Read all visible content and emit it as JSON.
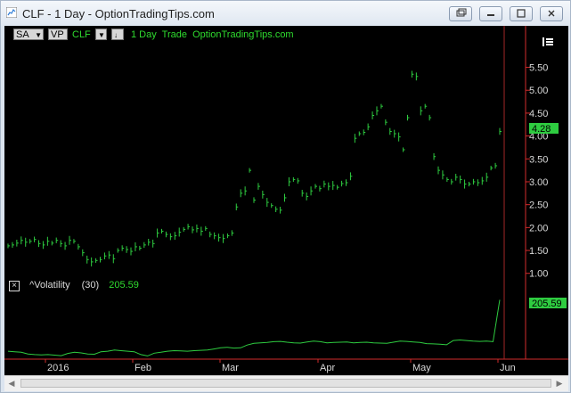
{
  "window": {
    "title": "CLF - 1 Day - OptionTradingTips.com"
  },
  "toolbar": {
    "sa_label": "SA",
    "vp_label": "VP",
    "symbol": "CLF",
    "description": "1 Day  Trade  OptionTradingTips.com"
  },
  "price_axis": {
    "ticks": [
      "5.50",
      "5.00",
      "4.50",
      "4.00",
      "3.50",
      "3.00",
      "2.50",
      "2.00",
      "1.50",
      "1.00"
    ],
    "last_price": "4.28"
  },
  "indicator": {
    "name": "^Volatility",
    "period": "(30)",
    "value": "205.59",
    "axis_value": "205.59"
  },
  "time_axis": {
    "labels": [
      "2016",
      "Feb",
      "Mar",
      "Apr",
      "May",
      "Jun"
    ]
  },
  "colors": {
    "background": "#000000",
    "price_bars": "#2ecc40",
    "volatility_line": "#2ecc40",
    "last_price_badge": "#2ecc40",
    "cursor_line": "#d22b2b",
    "axis_line": "#d22b2b",
    "text_green": "#2fdc2f"
  },
  "chart_data": {
    "type": "line",
    "series": [
      {
        "name": "CLF",
        "values": [
          1.6,
          1.62,
          1.66,
          1.72,
          1.68,
          1.7,
          1.74,
          1.65,
          1.62,
          1.7,
          1.66,
          1.72,
          1.65,
          1.6,
          1.72,
          1.7,
          1.58,
          1.45,
          1.3,
          1.25,
          1.28,
          1.3,
          1.38,
          1.4,
          1.32,
          1.5,
          1.55,
          1.52,
          1.48,
          1.58,
          1.55,
          1.62,
          1.68,
          1.65,
          1.88,
          1.92,
          1.85,
          1.8,
          1.82,
          1.9,
          1.96,
          2.02,
          1.95,
          1.98,
          1.92,
          1.98,
          1.85,
          1.82,
          1.78,
          1.76,
          1.82,
          1.88,
          2.45,
          2.75,
          2.8,
          3.25,
          2.6,
          2.9,
          2.72,
          2.55,
          2.48,
          2.4,
          2.38,
          2.65,
          3.0,
          3.05,
          3.02,
          2.75,
          2.68,
          2.8,
          2.9,
          2.85,
          2.95,
          2.9,
          2.92,
          2.88,
          2.96,
          2.98,
          3.12,
          3.95,
          4.05,
          4.08,
          4.2,
          4.45,
          4.55,
          4.65,
          4.3,
          4.1,
          4.05,
          3.98,
          3.7,
          4.4,
          5.35,
          5.3,
          4.55,
          4.65,
          4.4,
          3.55,
          3.25,
          3.15,
          3.05,
          3.0,
          3.1,
          3.05,
          2.95,
          2.95,
          3.0,
          2.98,
          3.02,
          3.1,
          3.3,
          3.35,
          4.1
        ]
      },
      {
        "name": "^Volatility",
        "values": [
          22,
          20,
          18,
          12,
          10,
          9,
          10,
          8,
          6,
          14,
          18,
          16,
          12,
          11,
          20,
          22,
          26,
          24,
          22,
          20,
          10,
          5,
          15,
          18,
          22,
          24,
          23,
          22,
          24,
          25,
          26,
          30,
          34,
          36,
          33,
          34,
          44,
          50,
          52,
          53,
          56,
          57,
          54,
          52,
          51,
          55,
          58,
          56,
          52,
          53,
          54,
          55,
          52,
          53,
          54,
          52,
          51,
          50,
          54,
          58,
          57,
          55,
          53,
          49,
          48,
          47,
          45,
          60,
          62,
          60,
          58,
          57,
          58,
          56,
          205.59
        ]
      }
    ],
    "x_labels": [
      "2016",
      "Feb",
      "Mar",
      "Apr",
      "May",
      "Jun"
    ],
    "ylim": [
      0.8,
      5.9
    ]
  }
}
